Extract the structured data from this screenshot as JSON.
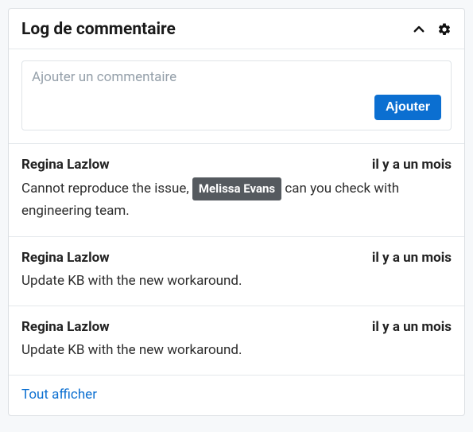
{
  "header": {
    "title": "Log de commentaire"
  },
  "composer": {
    "placeholder": "Ajouter un commentaire",
    "submit_label": "Ajouter"
  },
  "comments": [
    {
      "author": "Regina Lazlow",
      "time": "il y a un mois",
      "text_before": "Cannot reproduce the issue, ",
      "mention": "Melissa Evans",
      "text_after": " can you check with engineering team."
    },
    {
      "author": "Regina Lazlow",
      "time": "il y a un mois",
      "text_before": "Update KB with the new workaround.",
      "mention": null,
      "text_after": ""
    },
    {
      "author": "Regina Lazlow",
      "time": "il y a un mois",
      "text_before": "Update KB with the new workaround.",
      "mention": null,
      "text_after": ""
    }
  ],
  "footer": {
    "show_all_label": "Tout afficher"
  }
}
